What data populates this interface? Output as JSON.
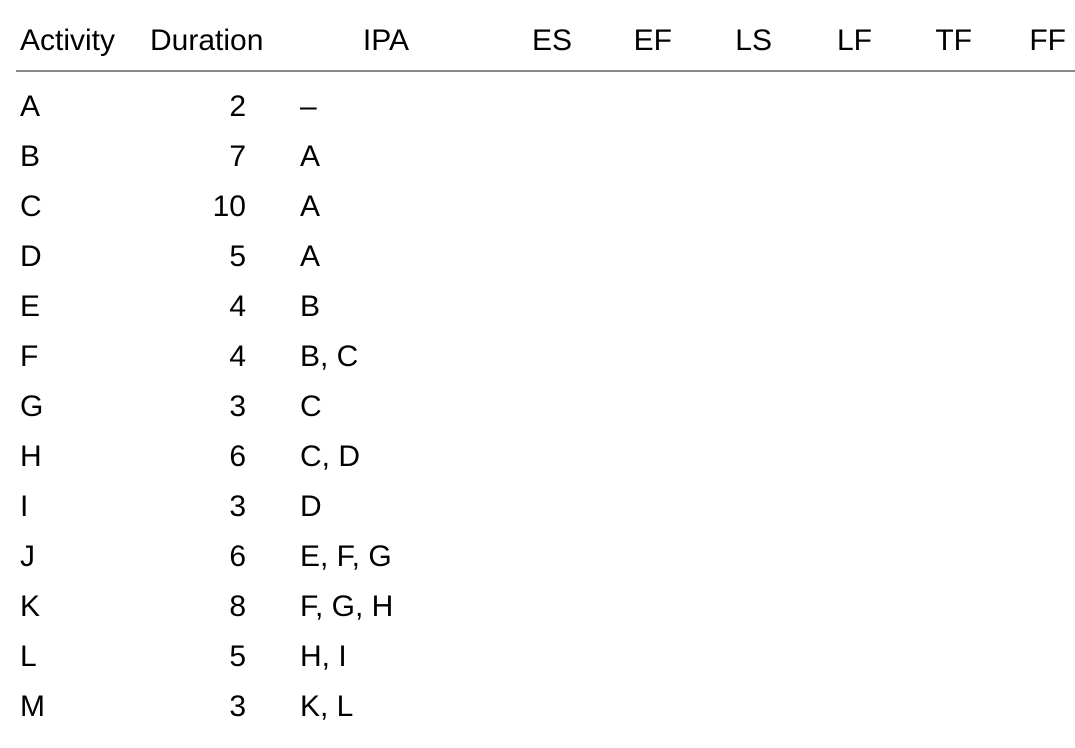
{
  "headers": {
    "activity": "Activity",
    "duration": "Duration",
    "ipa": "IPA",
    "es": "ES",
    "ef": "EF",
    "ls": "LS",
    "lf": "LF",
    "tf": "TF",
    "ff": "FF"
  },
  "rows": [
    {
      "activity": "A",
      "duration": "2",
      "ipa": "–",
      "es": "",
      "ef": "",
      "ls": "",
      "lf": "",
      "tf": "",
      "ff": ""
    },
    {
      "activity": "B",
      "duration": "7",
      "ipa": "A",
      "es": "",
      "ef": "",
      "ls": "",
      "lf": "",
      "tf": "",
      "ff": ""
    },
    {
      "activity": "C",
      "duration": "10",
      "ipa": "A",
      "es": "",
      "ef": "",
      "ls": "",
      "lf": "",
      "tf": "",
      "ff": ""
    },
    {
      "activity": "D",
      "duration": "5",
      "ipa": "A",
      "es": "",
      "ef": "",
      "ls": "",
      "lf": "",
      "tf": "",
      "ff": ""
    },
    {
      "activity": "E",
      "duration": "4",
      "ipa": "B",
      "es": "",
      "ef": "",
      "ls": "",
      "lf": "",
      "tf": "",
      "ff": ""
    },
    {
      "activity": "F",
      "duration": "4",
      "ipa": "B, C",
      "es": "",
      "ef": "",
      "ls": "",
      "lf": "",
      "tf": "",
      "ff": ""
    },
    {
      "activity": "G",
      "duration": "3",
      "ipa": "C",
      "es": "",
      "ef": "",
      "ls": "",
      "lf": "",
      "tf": "",
      "ff": ""
    },
    {
      "activity": "H",
      "duration": "6",
      "ipa": "C, D",
      "es": "",
      "ef": "",
      "ls": "",
      "lf": "",
      "tf": "",
      "ff": ""
    },
    {
      "activity": "I",
      "duration": "3",
      "ipa": "D",
      "es": "",
      "ef": "",
      "ls": "",
      "lf": "",
      "tf": "",
      "ff": ""
    },
    {
      "activity": "J",
      "duration": "6",
      "ipa": "E, F, G",
      "es": "",
      "ef": "",
      "ls": "",
      "lf": "",
      "tf": "",
      "ff": ""
    },
    {
      "activity": "K",
      "duration": "8",
      "ipa": "F, G, H",
      "es": "",
      "ef": "",
      "ls": "",
      "lf": "",
      "tf": "",
      "ff": ""
    },
    {
      "activity": "L",
      "duration": "5",
      "ipa": "H, I",
      "es": "",
      "ef": "",
      "ls": "",
      "lf": "",
      "tf": "",
      "ff": ""
    },
    {
      "activity": "M",
      "duration": "3",
      "ipa": "K, L",
      "es": "",
      "ef": "",
      "ls": "",
      "lf": "",
      "tf": "",
      "ff": ""
    }
  ]
}
